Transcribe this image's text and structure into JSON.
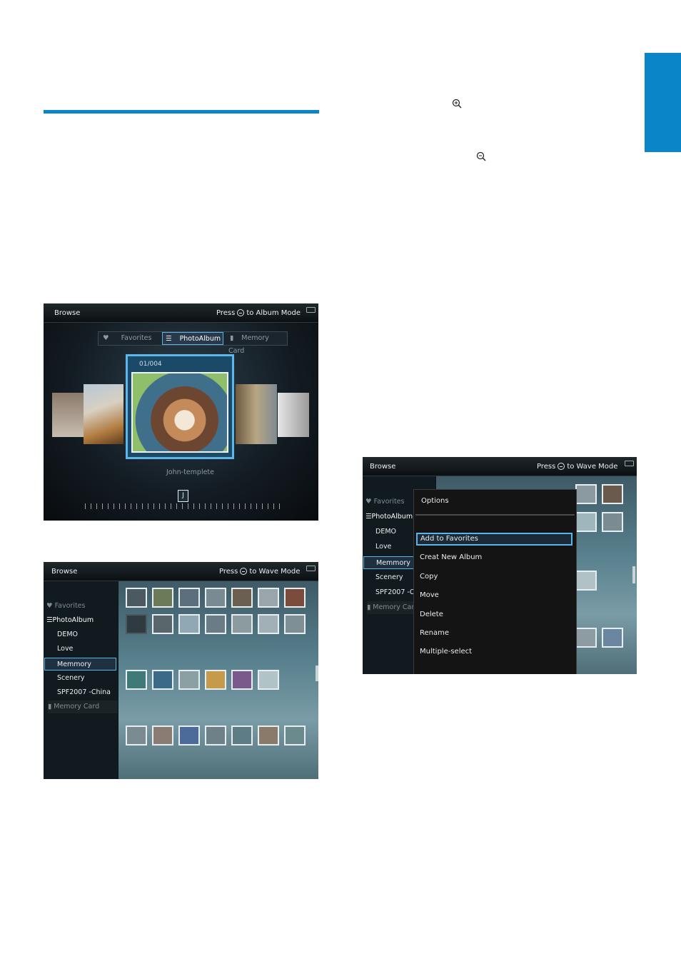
{
  "screen1": {
    "browse": "Browse",
    "press": "Press",
    "mode_text": "to Album Mode",
    "tabs": [
      "Favorites",
      "PhotoAlbum",
      "Memory Card"
    ],
    "counter": "01/004",
    "album_name": "John-templete",
    "slider_letter": "J"
  },
  "screen2": {
    "browse": "Browse",
    "press": "Press",
    "mode_text": "to Wave Mode",
    "sidebar": [
      "Favorites",
      "PhotoAlbum",
      "DEMO",
      "Love",
      "Memmory",
      "Scenery",
      "SPF2007  -China",
      "Memory Card"
    ]
  },
  "screen3": {
    "browse": "Browse",
    "press": "Press",
    "mode_text": "to Wave Mode",
    "sidebar": [
      "Favorites",
      "PhotoAlbum",
      "DEMO",
      "Love",
      "Memmory",
      "Scenery",
      "SPF2007  -C",
      "Memory Card"
    ],
    "menu_title": "Options",
    "menu_items": [
      "Add  to  Favorites",
      "Creat New Album",
      "Copy",
      "Move",
      "Delete",
      "Rename",
      "Multiple-select"
    ]
  },
  "icons": [
    "zoom-in-icon",
    "zoom-out-icon",
    "heart-icon",
    "album-icon",
    "memory-card-icon",
    "battery-icon"
  ],
  "colors": {
    "accent": "#0a86c8",
    "highlight": "#57b5ec"
  }
}
